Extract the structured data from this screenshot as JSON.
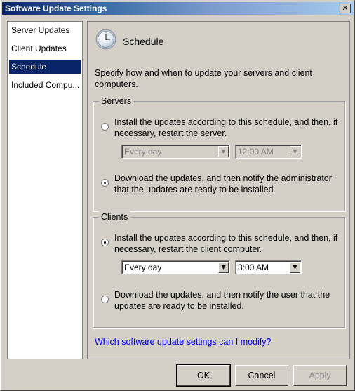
{
  "window": {
    "title": "Software Update Settings",
    "close_glyph": "✕"
  },
  "sidebar": {
    "items": [
      {
        "label": "Server Updates",
        "selected": false
      },
      {
        "label": "Client Updates",
        "selected": false
      },
      {
        "label": "Schedule",
        "selected": true
      },
      {
        "label": "Included Compu...",
        "selected": false
      }
    ]
  },
  "page": {
    "icon": "clock-icon",
    "heading": "Schedule",
    "description": "Specify how and when to update your servers and client computers."
  },
  "servers": {
    "legend": "Servers",
    "option_install": {
      "label": "Install the updates according to this schedule, and then, if necessary, restart the server.",
      "selected": false
    },
    "day_combo": {
      "value": "Every day",
      "enabled": false
    },
    "time_combo": {
      "value": "12:00 AM",
      "enabled": false
    },
    "option_notify": {
      "label": "Download the updates, and then notify the administrator that the updates are ready to be installed.",
      "selected": true
    }
  },
  "clients": {
    "legend": "Clients",
    "option_install": {
      "label": "Install the updates according to this schedule, and then, if necessary, restart the client computer.",
      "selected": true
    },
    "day_combo": {
      "value": "Every day",
      "enabled": true
    },
    "time_combo": {
      "value": "3:00 AM",
      "enabled": true
    },
    "option_notify": {
      "label": "Download the updates, and then notify the user that the updates are ready to be installed.",
      "selected": false
    }
  },
  "help_link": "Which software update settings can I modify?",
  "buttons": {
    "ok": "OK",
    "cancel": "Cancel",
    "apply": "Apply"
  },
  "combo_arrow_glyph": "▼"
}
